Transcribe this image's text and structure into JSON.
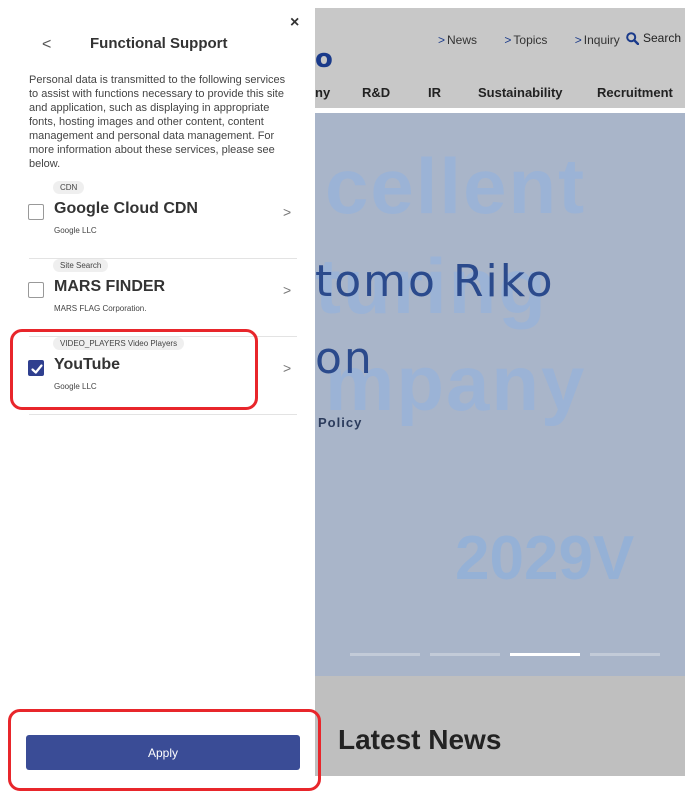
{
  "panel": {
    "title": "Functional Support",
    "back_glyph": "<",
    "close_glyph": "×",
    "description": "Personal data is transmitted to the following services to assist with functions necessary to provide this site and application, such as displaying in appropriate fonts, hosting images and other content, content management and personal data management. For more information about these services, please see below.",
    "services": [
      {
        "category": "CDN",
        "name": "Google Cloud CDN",
        "company": "Google LLC",
        "checked": false
      },
      {
        "category": "Site Search",
        "name": "MARS FINDER",
        "company": "MARS FLAG Corporation.",
        "checked": false
      },
      {
        "category": "VIDEO_PLAYERS Video Players",
        "name": "YouTube",
        "company": "Google LLC",
        "checked": true
      }
    ],
    "chevron_glyph": ">",
    "apply_label": "Apply",
    "accent_color": "#3a4c96"
  },
  "site": {
    "logo_fragment": "o",
    "top_links": [
      {
        "arrow": ">",
        "label": "News"
      },
      {
        "arrow": ">",
        "label": "Topics"
      },
      {
        "arrow": ">",
        "label": "Inquiry"
      }
    ],
    "search_label": "Search",
    "nav": [
      "ny",
      "R&D",
      "IR",
      "Sustainability",
      "Recruitment"
    ],
    "hero": {
      "bg_line1": "cellent",
      "bg_line2": "turing",
      "bg_line3": "mpany",
      "title_line1": "tomo Riko",
      "title_line2": "on",
      "policy": "Policy",
      "vision": "2029V"
    },
    "latest_news": "Latest News"
  },
  "annotation_color": "#e8262b"
}
